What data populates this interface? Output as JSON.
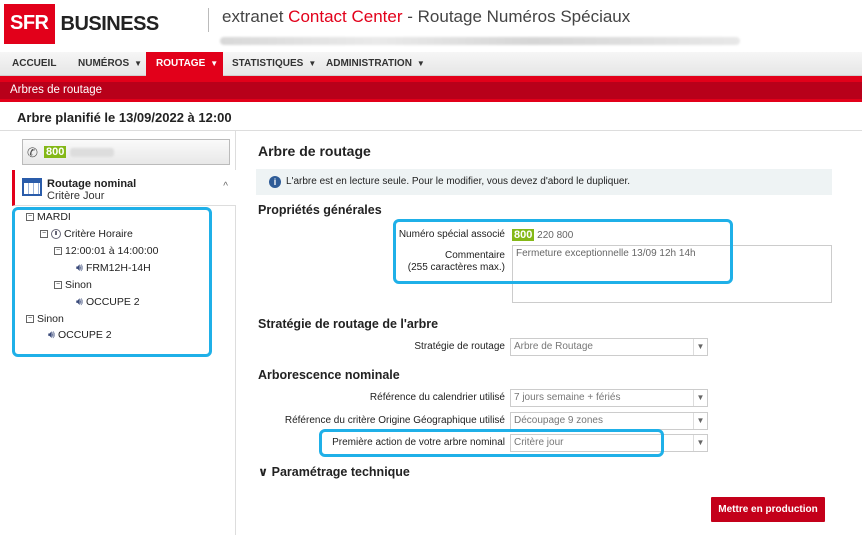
{
  "header": {
    "logo_sfr": "SFR",
    "logo_business": "BUSINESS",
    "title_prefix": "extranet",
    "title_brand": "Contact Center",
    "title_suffix": "- Routage Numéros Spéciaux"
  },
  "nav": {
    "items": [
      {
        "label": "ACCUEIL"
      },
      {
        "label": "NUMÉROS"
      },
      {
        "label": "ROUTAGE"
      },
      {
        "label": "STATISTIQUES"
      },
      {
        "label": "ADMINISTRATION"
      }
    ],
    "active": "ROUTAGE"
  },
  "page": {
    "section_title": "Arbres de routage",
    "subtitle": "Arbre planifié le 13/09/2022 à 12:00"
  },
  "left": {
    "number_prefix": "800",
    "card_title": "Routage nominal",
    "card_subtitle": "Critère Jour",
    "tree": {
      "mardi": "MARDI",
      "critere_horaire": "Critère Horaire",
      "plage": "12:00:01 à 14:00:00",
      "frm": "FRM12H-14H",
      "sinon1": "Sinon",
      "occupe1": "OCCUPE 2",
      "sinon2": "Sinon",
      "occupe2": "OCCUPE 2"
    }
  },
  "right": {
    "title": "Arbre de routage",
    "info": "L'arbre est en lecture seule. Pour le modifier, vous devez d'abord le dupliquer.",
    "props_title": "Propriétés générales",
    "num_label": "Numéro spécial associé",
    "num_badge": "800",
    "num_rest": "220 800",
    "comment_label": "Commentaire",
    "comment_hint": "(255 caractères max.)",
    "comment_value": "Fermeture exceptionnelle  13/09 12h 14h",
    "strategy_title": "Stratégie de routage de l'arbre",
    "strategy_label": "Stratégie de routage",
    "strategy_value": "Arbre de Routage",
    "arbo_title": "Arborescence nominale",
    "cal_label": "Référence du calendrier utilisé",
    "cal_value": "7 jours semaine + fériés",
    "geo_label": "Référence du critère Origine Géographique utilisé",
    "geo_value": "Découpage 9 zones",
    "first_label": "Première action de votre arbre nominal",
    "first_value": "Critère jour",
    "tech_title": "Paramétrage technique",
    "prod_button": "Mettre en production"
  },
  "colors": {
    "brand_red": "#e2001a",
    "highlight": "#1fb0e8",
    "green_badge": "#84b817"
  }
}
